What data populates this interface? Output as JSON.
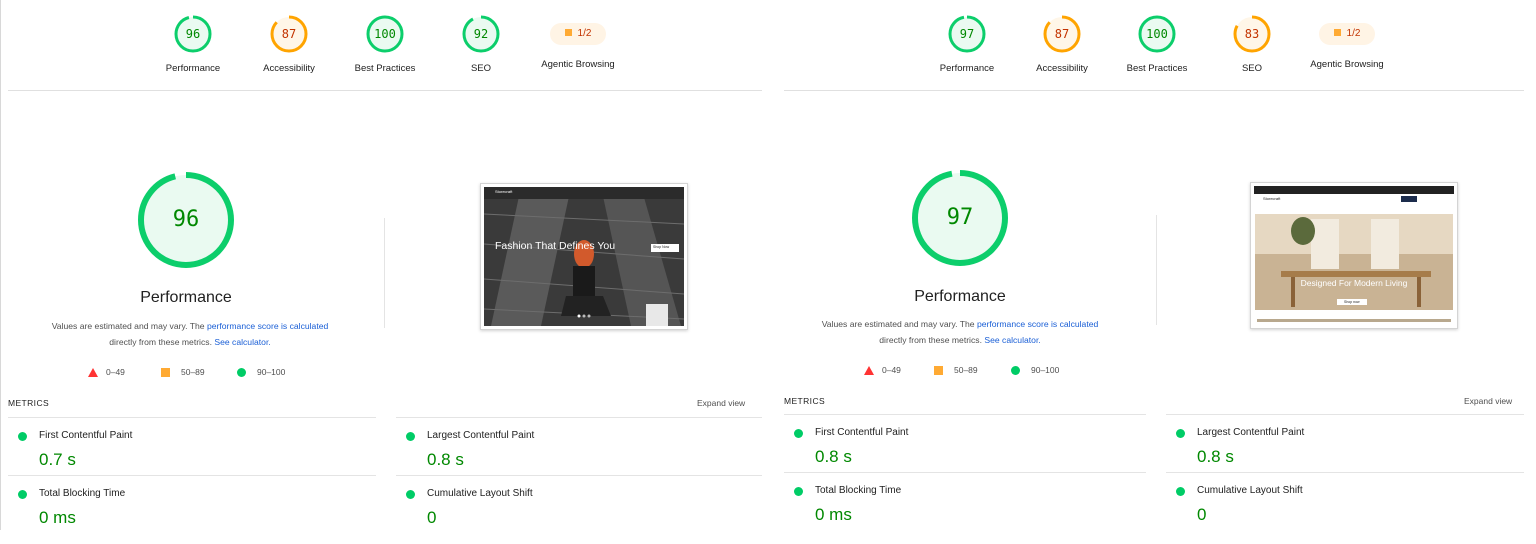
{
  "reports": [
    {
      "scores": [
        {
          "value": "96",
          "label": "Performance",
          "status": "pass"
        },
        {
          "value": "87",
          "label": "Accessibility",
          "status": "average"
        },
        {
          "value": "100",
          "label": "Best Practices",
          "status": "pass"
        },
        {
          "value": "92",
          "label": "SEO",
          "status": "pass"
        }
      ],
      "agentic": {
        "value": "1/2",
        "label": "Agentic Browsing"
      },
      "performance": {
        "score": "96",
        "title": "Performance",
        "desc_prefix": "Values are estimated and may vary. The",
        "desc_link1": "performance score is calculated",
        "desc_mid": "directly from these metrics.",
        "desc_link2": "See calculator."
      },
      "legend": {
        "fail": "0–49",
        "average": "50–89",
        "pass": "90–100"
      },
      "screenshot": {
        "brand": "Storecraft",
        "headline": "Fashion That Defines You",
        "cta": "Shop Now"
      },
      "metrics_header": "METRICS",
      "expand_label": "Expand view",
      "metrics": [
        {
          "name": "First Contentful Paint",
          "value": "0.7 s"
        },
        {
          "name": "Largest Contentful Paint",
          "value": "0.8 s"
        },
        {
          "name": "Total Blocking Time",
          "value": "0 ms"
        },
        {
          "name": "Cumulative Layout Shift",
          "value": "0"
        }
      ]
    },
    {
      "scores": [
        {
          "value": "97",
          "label": "Performance",
          "status": "pass"
        },
        {
          "value": "87",
          "label": "Accessibility",
          "status": "average"
        },
        {
          "value": "100",
          "label": "Best Practices",
          "status": "pass"
        },
        {
          "value": "83",
          "label": "SEO",
          "status": "average"
        }
      ],
      "agentic": {
        "value": "1/2",
        "label": "Agentic Browsing"
      },
      "performance": {
        "score": "97",
        "title": "Performance",
        "desc_prefix": "Values are estimated and may vary. The",
        "desc_link1": "performance score is calculated",
        "desc_mid": "directly from these metrics.",
        "desc_link2": "See calculator."
      },
      "legend": {
        "fail": "0–49",
        "average": "50–89",
        "pass": "90–100"
      },
      "screenshot": {
        "brand": "Storecraft",
        "headline": "Designed For Modern Living",
        "cta": "Shop now"
      },
      "metrics_header": "METRICS",
      "expand_label": "Expand view",
      "metrics": [
        {
          "name": "First Contentful Paint",
          "value": "0.8 s"
        },
        {
          "name": "Largest Contentful Paint",
          "value": "0.8 s"
        },
        {
          "name": "Total Blocking Time",
          "value": "0 ms"
        },
        {
          "name": "Cumulative Layout Shift",
          "value": "0"
        }
      ]
    }
  ],
  "colors": {
    "pass": "#0cce6b",
    "pass_text": "#008800",
    "average": "#ffa400",
    "average_text": "#c33300",
    "fail": "#ff3333"
  }
}
